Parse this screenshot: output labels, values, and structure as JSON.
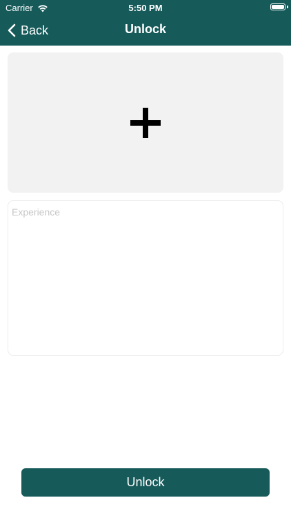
{
  "status_bar": {
    "carrier": "Carrier",
    "time": "5:50 PM",
    "battery_level": 1.0
  },
  "nav": {
    "back_label": "Back",
    "title": "Unlock"
  },
  "image_picker": {
    "icon": "plus-icon"
  },
  "experience": {
    "placeholder": "Experience",
    "value": ""
  },
  "unlock_button": {
    "label": "Unlock"
  },
  "colors": {
    "primary": "#175a5a",
    "picker_background": "#f2f2f2",
    "placeholder": "#c7c7c7"
  }
}
